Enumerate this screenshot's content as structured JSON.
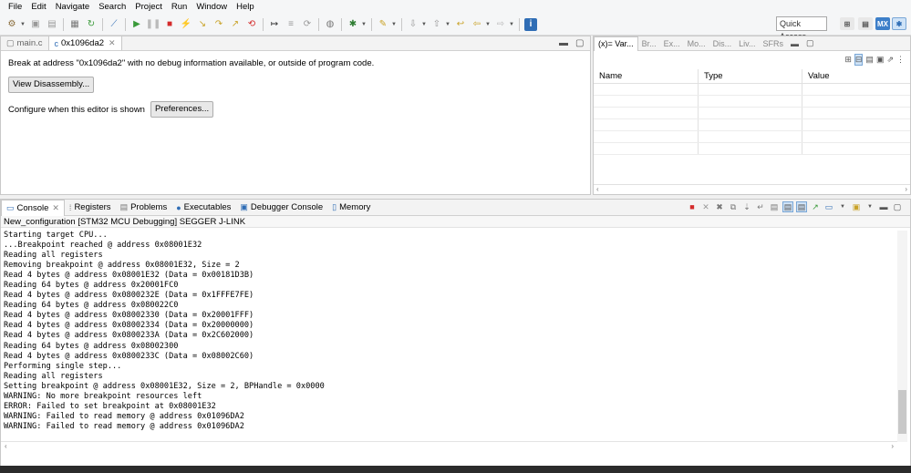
{
  "menubar": {
    "items": [
      "File",
      "Edit",
      "Navigate",
      "Search",
      "Project",
      "Run",
      "Window",
      "Help"
    ]
  },
  "toolbar": {
    "quick_access": "Quick Access",
    "mx_label": "MX",
    "icons": [
      "debug-config-icon",
      "save-icon",
      "save-all-icon",
      "build-icon",
      "skip-breakpoints-icon",
      "resume-icon",
      "suspend-icon",
      "terminate-icon",
      "disconnect-icon",
      "step-into-icon",
      "step-over-icon",
      "step-return-icon",
      "instruction-stepping-icon",
      "reset-icon",
      "debug-icon",
      "run-tool-icon",
      "next-annotation-icon",
      "prev-annotation-icon",
      "last-edit-icon",
      "back-icon",
      "forward-icon",
      "info-icon"
    ]
  },
  "editor": {
    "tabs": [
      {
        "label": "main.c",
        "icon": "c-file-icon"
      },
      {
        "label": "0x1096da2",
        "icon": "c-file-icon",
        "active": true
      }
    ],
    "message": "Break at address \"0x1096da2\" with no debug information available, or outside of program code.",
    "view_disassembly_button": "View Disassembly...",
    "configure_label": "Configure when this editor is shown",
    "preferences_button": "Preferences..."
  },
  "variables_panel": {
    "tabs": [
      "(x)= Var...",
      "Br...",
      "Ex...",
      "Mo...",
      "Dis...",
      "Liv...",
      "SFRs"
    ],
    "columns": [
      "Name",
      "Type",
      "Value"
    ]
  },
  "console": {
    "tabs": [
      {
        "label": "Console",
        "icon": "console-icon",
        "active": true
      },
      {
        "label": "Registers",
        "icon": "registers-icon"
      },
      {
        "label": "Problems",
        "icon": "problems-icon"
      },
      {
        "label": "Executables",
        "icon": "executables-icon"
      },
      {
        "label": "Debugger Console",
        "icon": "debugger-console-icon"
      },
      {
        "label": "Memory",
        "icon": "memory-icon"
      }
    ],
    "session_label": "New_configuration [STM32 MCU Debugging] SEGGER J-LINK",
    "lines": [
      "Starting target CPU...",
      "...Breakpoint reached @ address 0x08001E32",
      "Reading all registers",
      "Removing breakpoint @ address 0x08001E32, Size = 2",
      "Read 4 bytes @ address 0x08001E32 (Data = 0x00181D3B)",
      "Reading 64 bytes @ address 0x20001FC0",
      "Read 4 bytes @ address 0x0800232E (Data = 0x1FFFE7FE)",
      "Reading 64 bytes @ address 0x080022C0",
      "Read 4 bytes @ address 0x08002330 (Data = 0x20001FFF)",
      "Read 4 bytes @ address 0x08002334 (Data = 0x20000000)",
      "Read 4 bytes @ address 0x0800233A (Data = 0x2C602000)",
      "Reading 64 bytes @ address 0x08002300",
      "Read 4 bytes @ address 0x0800233C (Data = 0x08002C60)",
      "Performing single step...",
      "Reading all registers",
      "Setting breakpoint @ address 0x08001E32, Size = 2, BPHandle = 0x0000",
      "WARNING: No more breakpoint resources left",
      "ERROR: Failed to set breakpoint at 0x08001E32",
      "WARNING: Failed to read memory @ address 0x01096DA2",
      "WARNING: Failed to read memory @ address 0x01096DA2"
    ]
  },
  "colors": {
    "accent_blue": "#2f6db5",
    "terminate_red": "#d42b2b",
    "resume_green": "#3a9a3a",
    "mx_blue": "#3d7fc9"
  }
}
